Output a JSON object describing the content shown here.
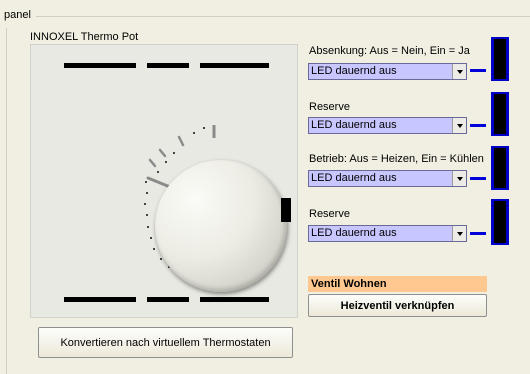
{
  "panel": {
    "title": "panel"
  },
  "device": {
    "name": "INNOXEL Thermo Pot",
    "convert_button": "Konvertieren nach virtuellem Thermostaten"
  },
  "controls": [
    {
      "label": "Absenkung: Aus = Nein, Ein = Ja",
      "selected": "LED dauernd aus"
    },
    {
      "label": "Reserve",
      "selected": "LED dauernd aus"
    },
    {
      "label": "Betrieb: Aus = Heizen, Ein = Kühlen",
      "selected": "LED dauernd aus"
    },
    {
      "label": "Reserve",
      "selected": "LED dauernd aus"
    }
  ],
  "valve": {
    "label": "Ventil Wohnen",
    "link_button": "Heizventil verknüpfen"
  },
  "colors": {
    "combo_bg": "#c8c6ff",
    "led_blue": "#0000d8",
    "valve_bg": "#ffc890"
  }
}
